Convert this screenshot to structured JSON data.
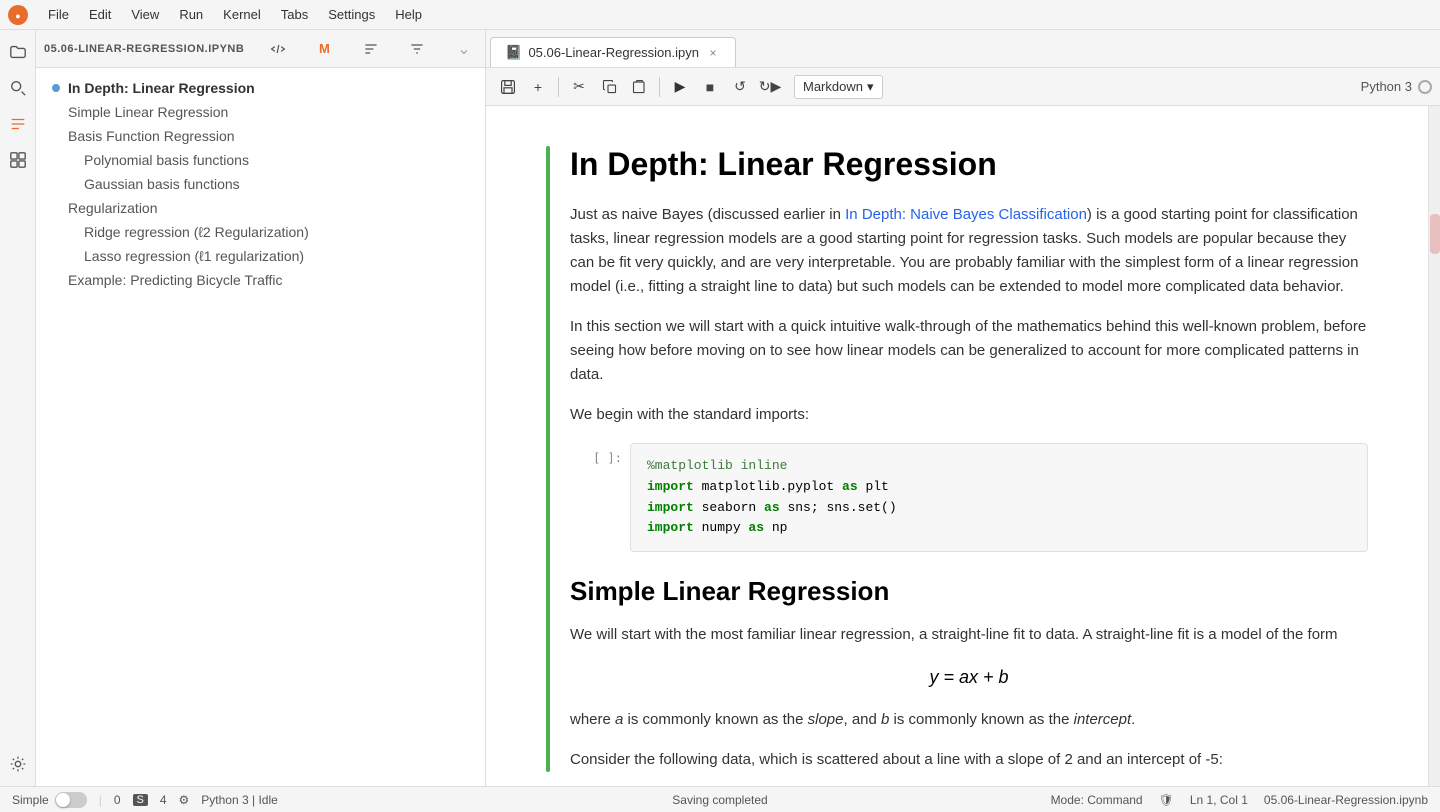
{
  "menubar": {
    "items": [
      "File",
      "Edit",
      "View",
      "Run",
      "Kernel",
      "Tabs",
      "Settings",
      "Help"
    ]
  },
  "sidebar": {
    "icons": [
      "folder",
      "search",
      "extensions",
      "debug",
      "git"
    ]
  },
  "file_panel": {
    "file_label": "05.06-LINEAR-REGRESSION.IPYNB",
    "toc_items": [
      {
        "level": 1,
        "label": "In Depth: Linear Regression",
        "active": true
      },
      {
        "level": 2,
        "label": "Simple Linear Regression",
        "active": false
      },
      {
        "level": 2,
        "label": "Basis Function Regression",
        "active": false
      },
      {
        "level": 3,
        "label": "Polynomial basis functions",
        "active": false
      },
      {
        "level": 3,
        "label": "Gaussian basis functions",
        "active": false
      },
      {
        "level": 2,
        "label": "Regularization",
        "active": false
      },
      {
        "level": 3,
        "label": "Ridge regression (ℓ2 Regularization)",
        "active": false
      },
      {
        "level": 3,
        "label": "Lasso regression (ℓ1 regularization)",
        "active": false
      },
      {
        "level": 2,
        "label": "Example: Predicting Bicycle Traffic",
        "active": false
      }
    ]
  },
  "notebook": {
    "tab_name": "05.06-Linear-Regression.ipyn",
    "kernel": "Python 3",
    "toolbar": {
      "cell_type": "Markdown"
    },
    "cells": [
      {
        "type": "markdown",
        "heading1": "In Depth: Linear Regression"
      },
      {
        "type": "paragraph",
        "text_before_link": "Just as naive Bayes (discussed earlier in ",
        "link_text": "In Depth: Naive Bayes Classification",
        "text_after_link": ") is a good starting point for classification tasks, linear regression models are a good starting point for regression tasks. Such models are popular because they can be fit very quickly, and are very interpretable. You are probably familiar with the simplest form of a linear regression model (i.e., fitting a straight line to data) but such models can be extended to model more complicated data behavior."
      },
      {
        "type": "paragraph",
        "text": "In this section we will start with a quick intuitive walk-through of the mathematics behind this well-known problem, before seeing how before moving on to see how linear models can be generalized to account for more complicated patterns in data."
      },
      {
        "type": "paragraph",
        "text": "We begin with the standard imports:"
      },
      {
        "type": "code",
        "prompt": "[ ]:",
        "lines": [
          {
            "tokens": [
              {
                "text": "%matplotlib inline",
                "class": "cm"
              }
            ]
          },
          {
            "tokens": [
              {
                "text": "import",
                "class": "kw"
              },
              {
                "text": " matplotlib.pyplot ",
                "class": ""
              },
              {
                "text": "as",
                "class": "kw"
              },
              {
                "text": " plt",
                "class": ""
              }
            ]
          },
          {
            "tokens": [
              {
                "text": "import",
                "class": "kw"
              },
              {
                "text": " seaborn ",
                "class": ""
              },
              {
                "text": "as",
                "class": "kw"
              },
              {
                "text": " sns; sns.set()",
                "class": ""
              }
            ]
          },
          {
            "tokens": [
              {
                "text": "import",
                "class": "kw"
              },
              {
                "text": " numpy ",
                "class": ""
              },
              {
                "text": "as",
                "class": "kw"
              },
              {
                "text": " np",
                "class": ""
              }
            ]
          }
        ]
      },
      {
        "type": "markdown",
        "heading2": "Simple Linear Regression"
      },
      {
        "type": "paragraph",
        "text": "We will start with the most familiar linear regression, a straight-line fit to data. A straight-line fit is a model of the form"
      },
      {
        "type": "math",
        "formula": "y = ax + b"
      },
      {
        "type": "paragraph_mixed",
        "parts": [
          {
            "text": "where ",
            "style": ""
          },
          {
            "text": "a",
            "style": "italic"
          },
          {
            "text": " is commonly known as the ",
            "style": ""
          },
          {
            "text": "slope",
            "style": "italic"
          },
          {
            "text": ", and ",
            "style": ""
          },
          {
            "text": "b",
            "style": "italic"
          },
          {
            "text": " is commonly known as the ",
            "style": ""
          },
          {
            "text": "intercept",
            "style": "italic"
          },
          {
            "text": ".",
            "style": ""
          }
        ]
      },
      {
        "type": "paragraph",
        "text": "Consider the following data, which is scattered about a line with a slope of 2 and an intercept of -5:"
      }
    ]
  },
  "statusbar": {
    "simple_label": "Simple",
    "cell_count": "0",
    "s_label": "S",
    "num_label": "4",
    "python_status": "Python 3 | Idle",
    "center_text": "Saving completed",
    "mode_label": "Mode: Command",
    "position_label": "Ln 1, Col 1",
    "file_label": "05.06-Linear-Regression.ipynb"
  }
}
